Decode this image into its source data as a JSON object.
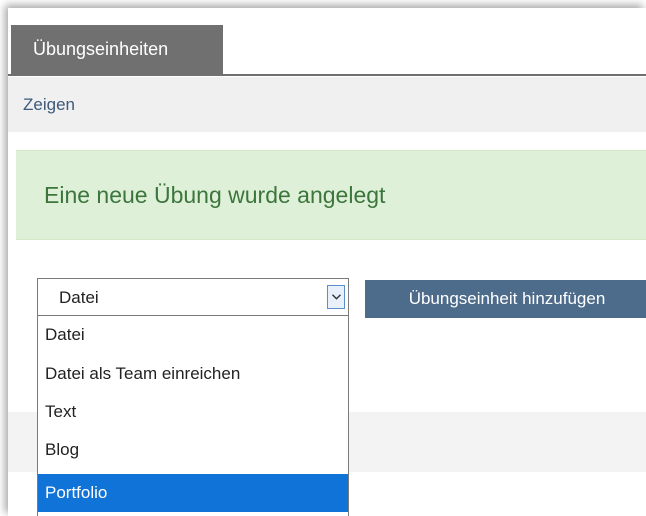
{
  "tabs": {
    "active_label": "Übungseinheiten"
  },
  "subnav": {
    "link_label": "Zeigen"
  },
  "alert": {
    "message": "Eine neue Übung wurde angelegt"
  },
  "form": {
    "select_value": "Datei",
    "add_button_label": "Übungseinheit hinzufügen",
    "options": [
      "Datei",
      "Datei als Team einreichen",
      "Text",
      "Blog",
      "Portfolio"
    ],
    "highlighted_option": "Portfolio"
  },
  "colors": {
    "tab_bg": "#707070",
    "alert_bg": "#dff0d8",
    "alert_text": "#3c763d",
    "button_bg": "#4d6b8a",
    "option_highlight": "#0f73d8"
  },
  "icons": {
    "select_arrow": "chevron-down-icon"
  }
}
